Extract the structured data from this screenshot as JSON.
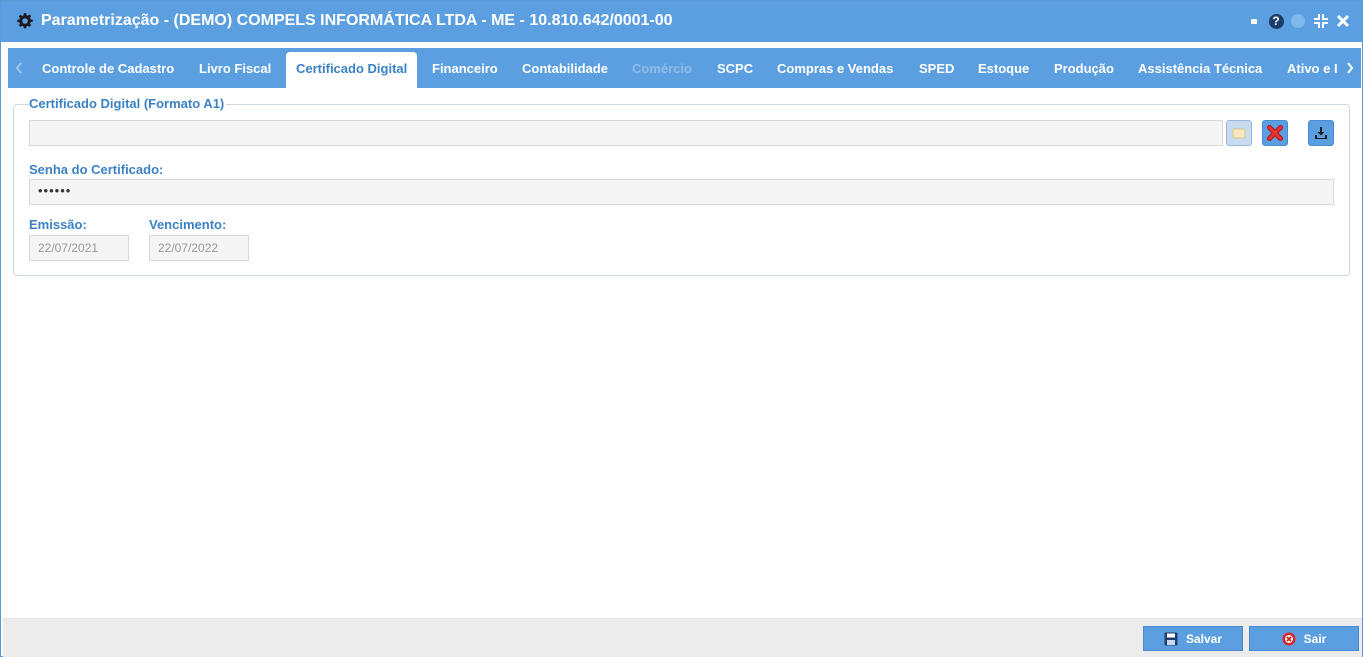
{
  "window": {
    "title": "Parametrização - (DEMO) COMPELS INFORMÁTICA LTDA - ME - 10.810.642/0001-00",
    "controls": {
      "help_label": "?"
    }
  },
  "tabs": [
    {
      "label": "Controle de Cadastro",
      "state": "normal"
    },
    {
      "label": "Livro Fiscal",
      "state": "normal"
    },
    {
      "label": "Certificado Digital",
      "state": "active"
    },
    {
      "label": "Financeiro",
      "state": "normal"
    },
    {
      "label": "Contabilidade",
      "state": "normal"
    },
    {
      "label": "Comércio",
      "state": "disabled"
    },
    {
      "label": "SCPC",
      "state": "normal"
    },
    {
      "label": "Compras e Vendas",
      "state": "normal"
    },
    {
      "label": "SPED",
      "state": "normal"
    },
    {
      "label": "Estoque",
      "state": "normal"
    },
    {
      "label": "Produção",
      "state": "normal"
    },
    {
      "label": "Assistência Técnica",
      "state": "normal"
    },
    {
      "label": "Ativo e I",
      "state": "normal"
    }
  ],
  "certificate": {
    "legend": "Certificado Digital (Formato A1)",
    "file_value": "",
    "password_label": "Senha do Certificado:",
    "password_value": "••••••",
    "issue_label": "Emissão:",
    "issue_value": "22/07/2021",
    "expiry_label": "Vencimento:",
    "expiry_value": "22/07/2022"
  },
  "footer": {
    "save_label": "Salvar",
    "exit_label": "Sair"
  },
  "colors": {
    "accent": "#5b9fe0",
    "label": "#3b82c4",
    "delete": "#e02b2b"
  },
  "icons": {
    "title": "gear-icon",
    "file": "folder-icon",
    "delete": "delete-x-icon",
    "upload": "upload-icon",
    "save": "floppy-disk-icon",
    "exit": "exit-icon"
  }
}
